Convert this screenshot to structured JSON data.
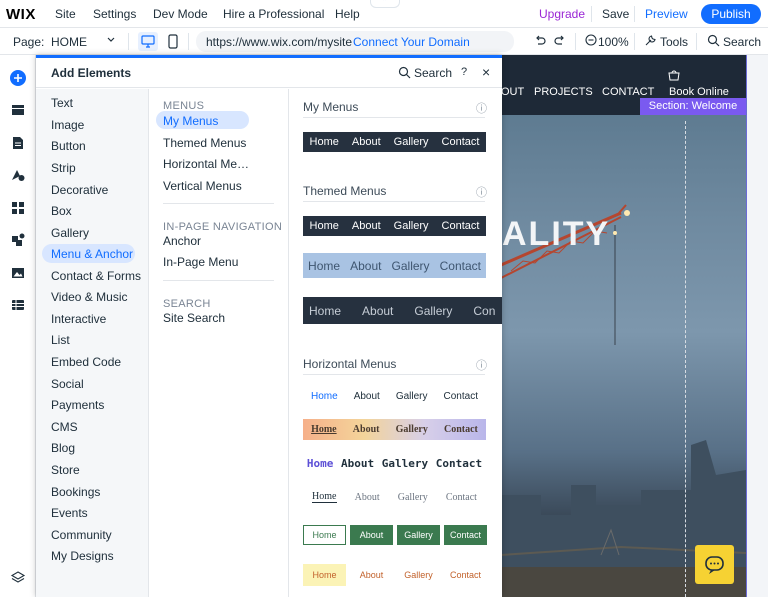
{
  "topbar": {
    "logo": "WIX",
    "menu": [
      "Site",
      "Settings",
      "Dev Mode",
      "Hire a Professional",
      "Help"
    ],
    "upgrade": "Upgrade",
    "save": "Save",
    "preview": "Preview",
    "publish": "Publish",
    "notch_glyph": "⌃"
  },
  "pagebar": {
    "page_label": "Page:",
    "page_value": "HOME",
    "url": "https://www.wix.com/mysite",
    "connect_domain": "Connect Your Domain",
    "zoom": "100%",
    "tools": "Tools",
    "search": "Search"
  },
  "panel": {
    "title": "Add Elements",
    "search": "Search",
    "help": "?",
    "close": "×",
    "categories": [
      "Text",
      "Image",
      "Button",
      "Strip",
      "Decorative",
      "Box",
      "Gallery",
      "Menu & Anchor",
      "Contact & Forms",
      "Video & Music",
      "Interactive",
      "List",
      "Embed Code",
      "Social",
      "Payments",
      "CMS",
      "Blog",
      "Store",
      "Bookings",
      "Events",
      "Community",
      "My Designs"
    ],
    "selected_category": "Menu & Anchor",
    "subsections": {
      "menus_heading": "MENUS",
      "menus_items": [
        "My Menus",
        "Themed Menus",
        "Horizontal Me…",
        "Vertical Menus"
      ],
      "inpage_heading": "IN-PAGE NAVIGATION",
      "inpage_items": [
        "Anchor",
        "In-Page Menu"
      ],
      "search_heading": "SEARCH",
      "search_items": [
        "Site Search"
      ]
    },
    "content": {
      "my_menus_heading": "My Menus",
      "themed_heading": "Themed Menus",
      "horizontal_heading": "Horizontal Menus",
      "info_glyph": "ⓘ",
      "menu_items": [
        "Home",
        "About",
        "Gallery",
        "Contact"
      ],
      "menu_items_cut": [
        "Home",
        "About",
        "Gallery",
        "Con"
      ]
    }
  },
  "canvas": {
    "nav": [
      "OUT",
      "PROJECTS",
      "CONTACT",
      "Book Online"
    ],
    "section_badge": "Section: Welcome",
    "hero_text": "ALITY"
  },
  "colors": {
    "accent": "#116dff",
    "upgrade": "#9a27d5",
    "dark_menu": "#26313f",
    "light_menu": "#a9c3e3",
    "green_menu": "#3b7a4f"
  }
}
